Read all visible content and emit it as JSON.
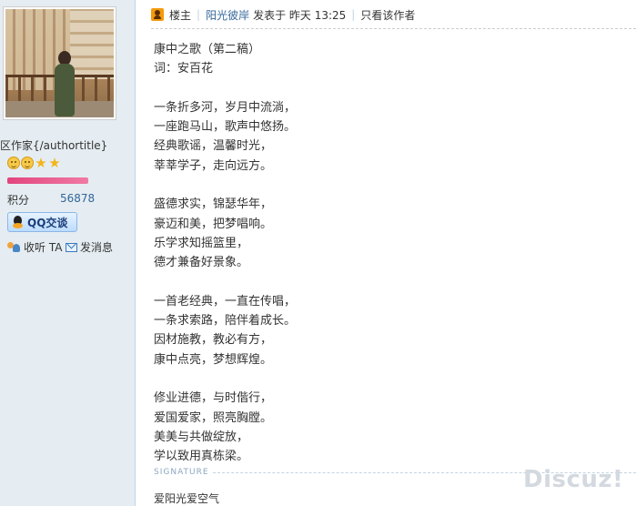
{
  "sidebar": {
    "author_title": "区作家{/authortitle}",
    "level_icons": [
      "smile-icon",
      "smile-icon",
      "star-icon",
      "star-icon"
    ],
    "level_progress_percent": 100,
    "credits_label": "积分",
    "credits_value": "56878",
    "qq_button_label": "QQ交谈",
    "follow_label": "收听 TA",
    "message_label": "发消息"
  },
  "post": {
    "floor_label": "楼主",
    "separator": "|",
    "author_name": "阳光彼岸",
    "posted_label": "发表于 昨天 13:25",
    "only_author_label": "只看该作者",
    "lines": [
      "康中之歌（第二稿）",
      "词：安百花",
      "",
      "一条折多河，岁月中流淌，",
      "一座跑马山，歌声中悠扬。",
      "经典歌谣，温馨时光，",
      "莘莘学子，走向远方。",
      "",
      "盛德求实，锦瑟华年，",
      "豪迈和美，把梦唱响。",
      "乐学求知摇篮里，",
      "德才兼备好景象。",
      "",
      "一首老经典，一直在传唱，",
      "一条求索路，陪伴着成长。",
      "因材施教，教必有方，",
      "康中点亮，梦想辉煌。",
      "",
      "修业进德，与时偕行，",
      "爱国爱家，照亮胸膛。",
      "美美与共做绽放，",
      "学以致用真栋梁。"
    ]
  },
  "signature": {
    "label": "SIGNATURE",
    "text": "爱阳光爱空气"
  },
  "watermark": "Discuz!",
  "colors": {
    "sidebar_bg": "#e5edf2",
    "link": "#336699",
    "progress": "#e2457d",
    "online_badge": "#f49b0a"
  }
}
